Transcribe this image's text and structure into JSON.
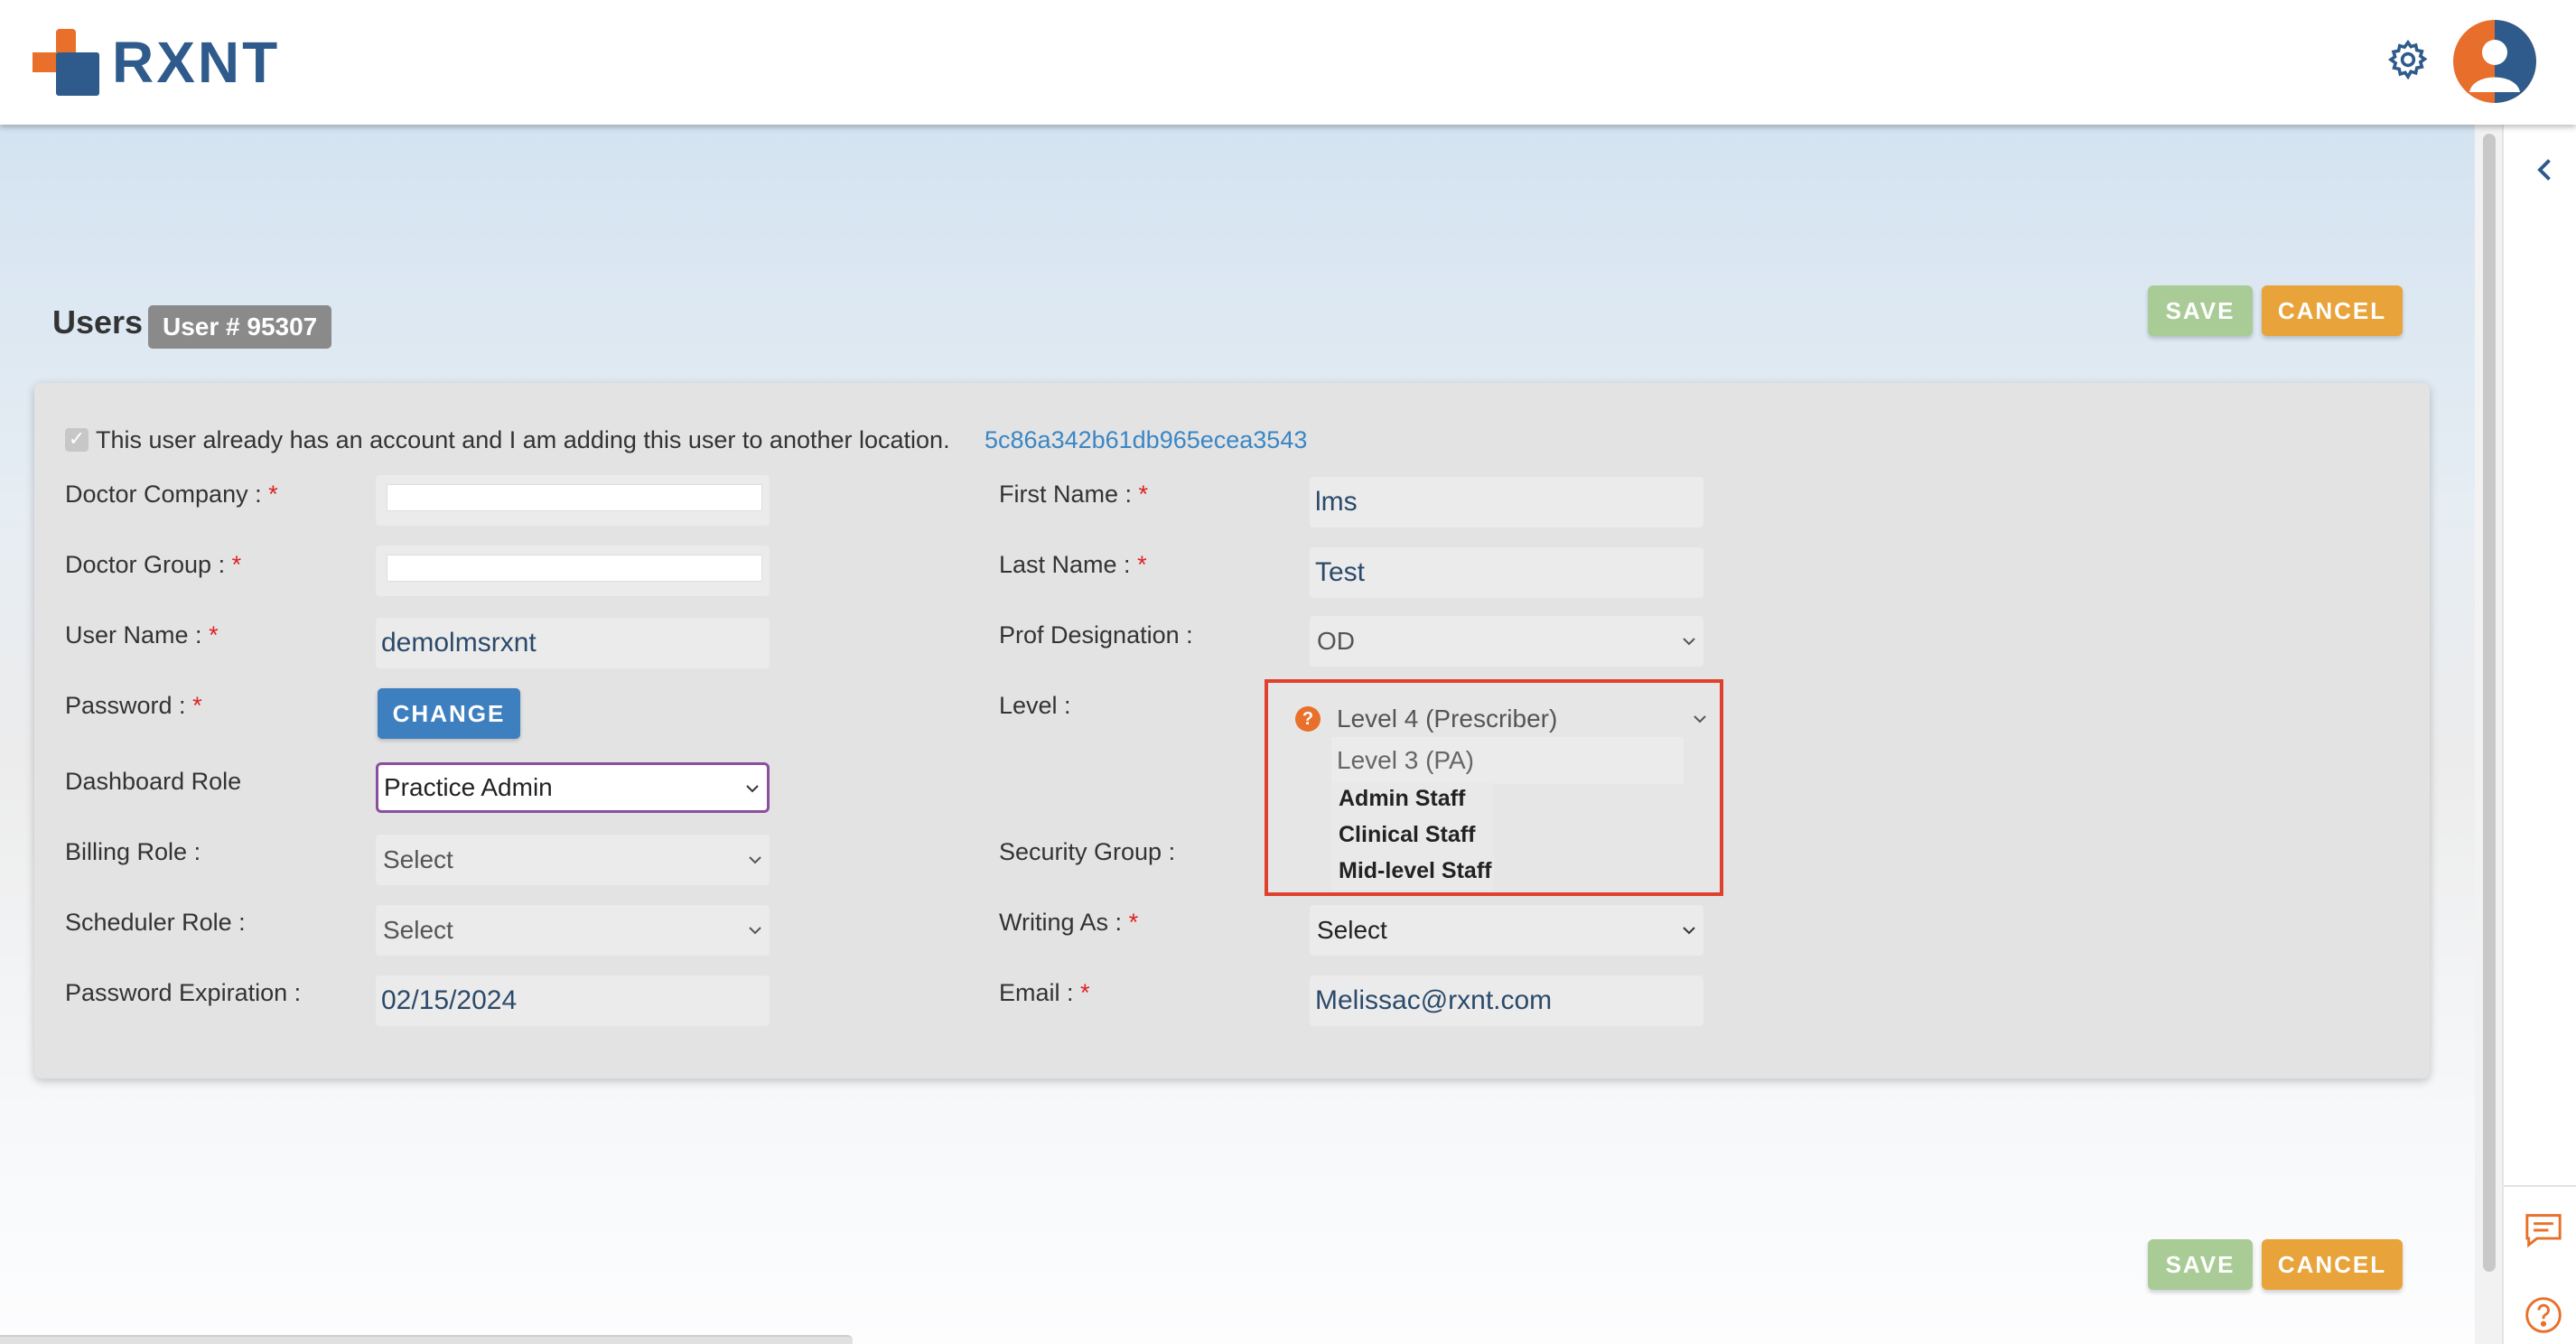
{
  "header": {
    "logo_text": "RXNT"
  },
  "page": {
    "title": "Users",
    "user_badge": "User # 95307"
  },
  "actions": {
    "save_label": "SAVE",
    "cancel_label": "CANCEL"
  },
  "form": {
    "existing_account_label": "This user already has an account and I am adding this user to another location.",
    "existing_account_checked": true,
    "account_id_link": "5c86a342b61db965ecea3543",
    "required_marker": "*",
    "doctor_company": {
      "label": "Doctor Company :",
      "value": ""
    },
    "doctor_group": {
      "label": "Doctor Group :",
      "value": ""
    },
    "user_name": {
      "label": "User Name :",
      "value": "demolmsrxnt"
    },
    "password": {
      "label": "Password :",
      "button": "CHANGE"
    },
    "dashboard_role": {
      "label": "Dashboard Role",
      "value": "Practice Admin"
    },
    "billing_role": {
      "label": "Billing Role :",
      "value": "Select"
    },
    "scheduler_role": {
      "label": "Scheduler Role :",
      "value": "Select"
    },
    "password_expiration": {
      "label": "Password Expiration :",
      "value": "02/15/2024"
    },
    "first_name": {
      "label": "First Name :",
      "value": "lms"
    },
    "last_name": {
      "label": "Last Name :",
      "value": "Test"
    },
    "prof_designation": {
      "label": "Prof Designation :",
      "value": "OD"
    },
    "level": {
      "label": "Level :",
      "value": "Level 4 (Prescriber)",
      "options": [
        "Level 3 (PA)",
        "Admin Staff",
        "Clinical Staff",
        "Mid-level Staff"
      ]
    },
    "security_group": {
      "label": "Security Group :"
    },
    "writing_as": {
      "label": "Writing As :",
      "value": "Select"
    },
    "email": {
      "label": "Email :",
      "value": "Melissac@rxnt.com"
    }
  },
  "colors": {
    "brand_blue": "#2e5b8c",
    "brand_orange": "#e8702a",
    "save_button": "#a9cc96",
    "cancel_button": "#e8a33a",
    "change_button": "#3e7fc0",
    "highlight_border": "#e0412f"
  },
  "icons": {
    "settings": "gear-icon",
    "profile": "avatar",
    "collapse": "chevron-left-icon",
    "chat": "chat-icon",
    "help": "help-icon"
  }
}
